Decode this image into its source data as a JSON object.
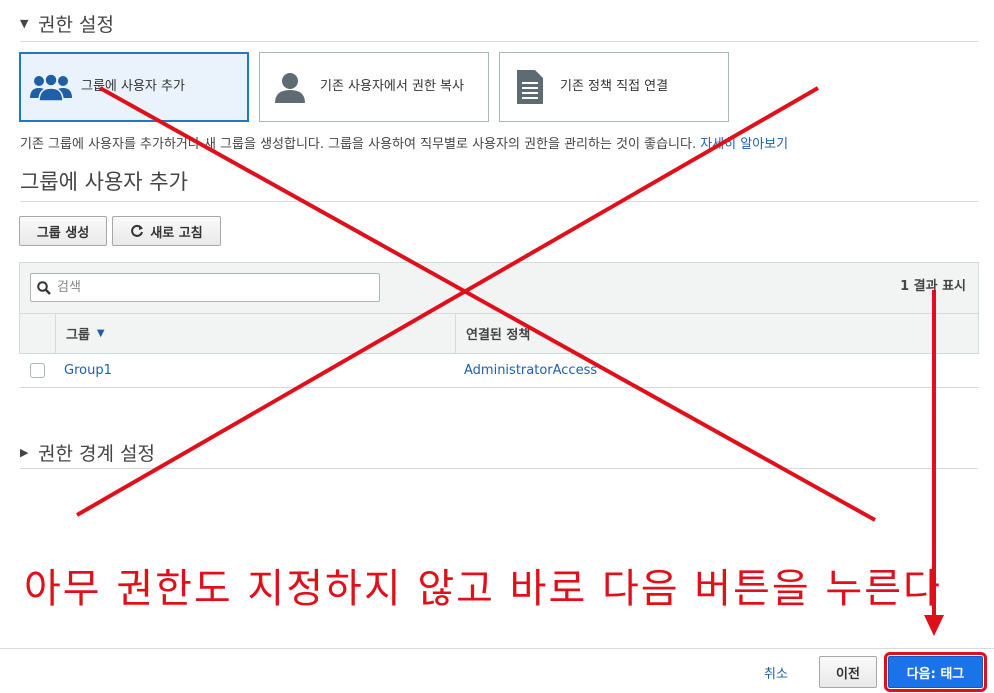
{
  "permissions": {
    "section_title": "권한 설정",
    "options": [
      {
        "label": "그룹에 사용자 추가",
        "icon": "users-group-icon",
        "selected": true
      },
      {
        "label": "기존 사용자에서 권한 복사",
        "icon": "user-icon",
        "selected": false
      },
      {
        "label": "기존 정책 직접 연결",
        "icon": "document-icon",
        "selected": false
      }
    ],
    "description": "기존 그룹에 사용자를 추가하거나 새 그룹을 생성합니다. 그룹을 사용하여 직무별로 사용자의 권한을 관리하는 것이 좋습니다.",
    "learn_more": "자세히 알아보기"
  },
  "add_to_group": {
    "title": "그룹에 사용자 추가",
    "create_group_label": "그룹 생성",
    "refresh_label": "새로 고침",
    "search_placeholder": "검색",
    "result_count": "1 결과 표시",
    "columns": {
      "group": "그룹",
      "attached_policy": "연결된 정책"
    },
    "rows": [
      {
        "group": "Group1",
        "policy": "AdministratorAccess"
      }
    ]
  },
  "boundary": {
    "section_title": "권한 경계 설정"
  },
  "footer": {
    "cancel_label": "취소",
    "previous_label": "이전",
    "next_label": "다음: 태그"
  },
  "annotation": {
    "text": "아무 권한도 지정하지 않고 바로 다음 버튼을 누른다",
    "color": "#e0101b"
  },
  "colors": {
    "accent": "#1a73e8",
    "link": "#1e5fa8",
    "selected_border": "#1e78c6"
  }
}
